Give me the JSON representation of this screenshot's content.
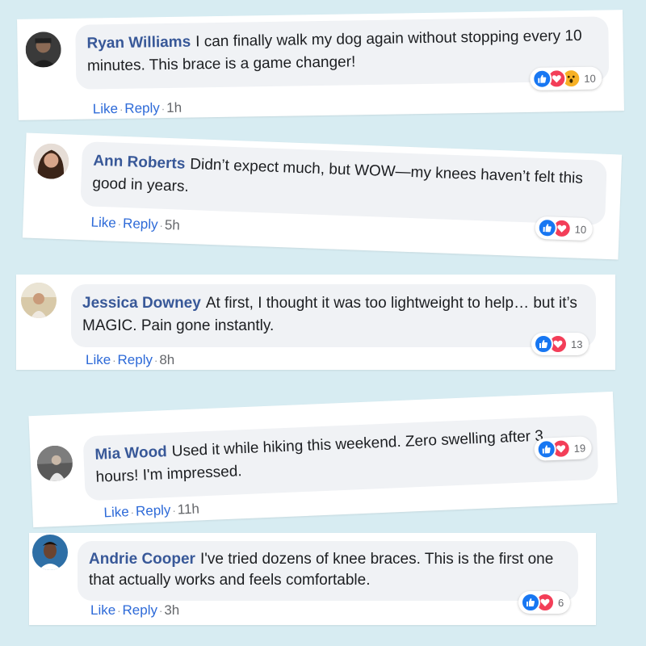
{
  "comments": [
    {
      "name": "Ryan Williams",
      "text": "I can finally walk my dog again without stopping every 10 minutes. This brace is a game changer!",
      "like": "Like",
      "reply": "Reply",
      "time": "1h",
      "reaction_icons": [
        "like-icon",
        "love-icon",
        "wow-icon"
      ],
      "reaction_count": "10"
    },
    {
      "name": "Ann Roberts",
      "text": "Didn’t expect much, but WOW—my knees haven’t felt this good in years.",
      "like": "Like",
      "reply": "Reply",
      "time": "5h",
      "reaction_icons": [
        "like-icon",
        "love-icon"
      ],
      "reaction_count": "10"
    },
    {
      "name": "Jessica Downey",
      "text": "At first, I thought it was too lightweight to help… but it’s MAGIC. Pain gone instantly.",
      "like": "Like",
      "reply": "Reply",
      "time": "8h",
      "reaction_icons": [
        "like-icon",
        "love-icon"
      ],
      "reaction_count": "13"
    },
    {
      "name": "Mia Wood",
      "text": "Used it while hiking this weekend. Zero swelling after 3 hours! I'm impressed.",
      "like": "Like",
      "reply": "Reply",
      "time": "11h",
      "reaction_icons": [
        "like-icon",
        "love-icon"
      ],
      "reaction_count": "19"
    },
    {
      "name": "Andrie Cooper",
      "text": "I've tried dozens of knee braces. This is the first one that actually works and feels comfortable.",
      "like": "Like",
      "reply": "Reply",
      "time": "3h",
      "reaction_icons": [
        "like-icon",
        "love-icon"
      ],
      "reaction_count": "6"
    }
  ],
  "colors": {
    "background": "#d7ecf2",
    "name": "#385898",
    "link": "#2d6ad8",
    "like_reaction": "#1877f2",
    "love_reaction": "#f33e58",
    "wow_reaction": "#f7b125"
  }
}
